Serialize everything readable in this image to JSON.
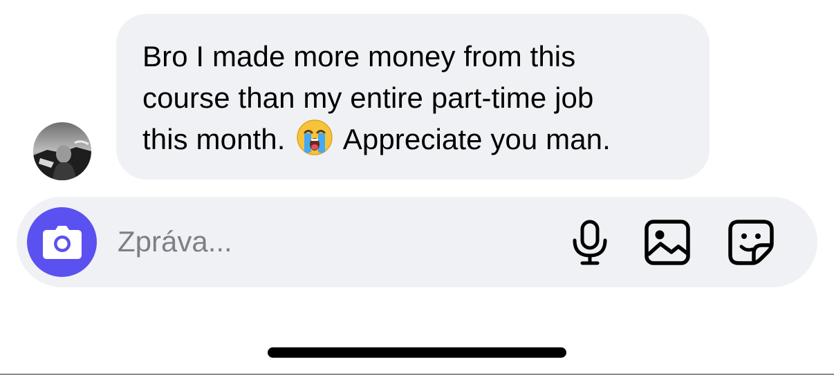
{
  "conversation": {
    "incoming_message": {
      "lines": [
        "Bro I made more money from this",
        "course than my entire part-time job",
        "this month."
      ],
      "emoji": "😭",
      "emoji_name": "loudly-crying-face",
      "line3_after_emoji": "Appreciate you man.",
      "avatar_icon": "user-avatar-photo"
    }
  },
  "composer": {
    "placeholder": "Zpráva...",
    "value": "",
    "camera_icon": "camera-icon",
    "mic_icon": "microphone-icon",
    "gallery_icon": "image-gallery-icon",
    "sticker_icon": "sticker-icon"
  },
  "colors": {
    "bubble_background": "#f0f1f4",
    "camera_button": "#5b51f0",
    "placeholder_text": "#7b8088",
    "home_indicator": "#000000"
  }
}
